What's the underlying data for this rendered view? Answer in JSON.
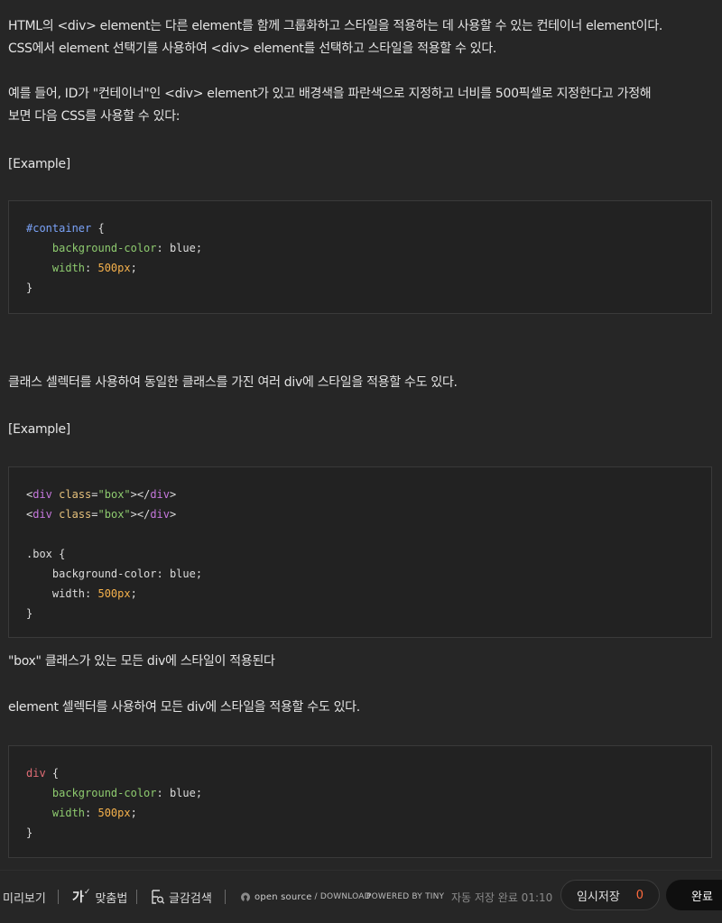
{
  "paragraphs": {
    "p1_line1": "HTML의 <div> element는 다른 element를 함께 그룹화하고 스타일을 적용하는 데 사용할 수 있는 컨테이너 element이다.",
    "p1_line2": "CSS에서 element 선택기를 사용하여 <div> element를 선택하고 스타일을 적용할 수 있다.",
    "p2_line1": "예를 들어, ID가 \"컨테이너\"인 <div> element가 있고 배경색을 파란색으로 지정하고 너비를 500픽셀로 지정한다고 가정해",
    "p2_line2": "보면 다음 CSS를 사용할 수 있다:",
    "example1": "[Example]",
    "p3": "클래스 셀렉터를 사용하여 동일한 클래스를 가진 여러 div에 스타일을 적용할 수도 있다.",
    "example2": "[Example]",
    "p4": "\"box\" 클래스가 있는 모든 div에 스타일이 적용된다",
    "p5": "element 셀렉터를 사용하여 모든 div에 스타일을 적용할 수도 있다."
  },
  "code1": {
    "selector": "#container",
    "open": " {",
    "prop1": "background-color",
    "val1": " blue;",
    "prop2": "width",
    "val2_num": "500px",
    "close": "}"
  },
  "code2": {
    "lt": "<",
    "tag": "div",
    "attr": "class",
    "eq": "=",
    "str": "\"box\"",
    "gt": ">",
    "endtag_open": "</",
    "endtag": "div",
    "selector": ".box {",
    "prop1": "background-color: blue;",
    "prop2_name": "width: ",
    "prop2_num": "500px",
    "semi": ";",
    "close": "}"
  },
  "code3": {
    "selector": "div",
    "open": " {",
    "prop1": "background-color",
    "val1": " blue;",
    "prop2": "width",
    "val2_num": "500px",
    "close": "}"
  },
  "footer": {
    "preview": "미리보기",
    "spellcheck": "맞춤법",
    "spell_icon_text": "가",
    "search": "글감검색",
    "open_source": "open source",
    "download": "/ DOWNLOAD",
    "powered": "POWERED BY TINY",
    "autosave": "자동 저장 완료 01:10",
    "draft": "임시저장",
    "draft_count": "0",
    "done": "완료"
  }
}
